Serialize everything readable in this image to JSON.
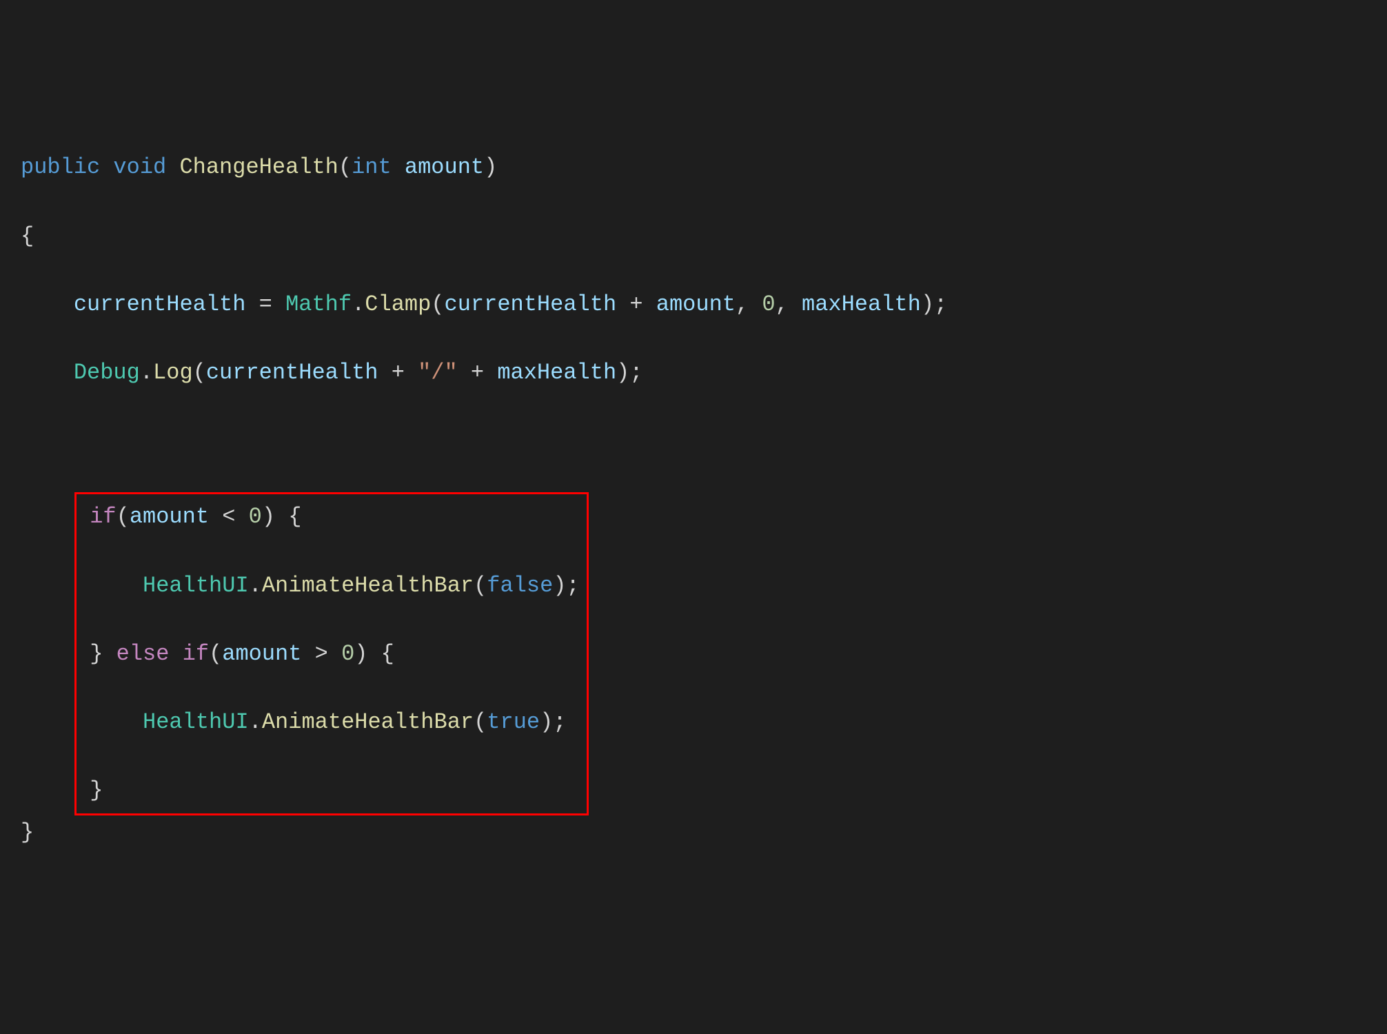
{
  "code": {
    "line1": {
      "kw_public": "public",
      "kw_void": "void",
      "method_name": "ChangeHealth",
      "kw_int": "int",
      "param_name": "amount"
    },
    "line2": {
      "brace": "{"
    },
    "line3": {
      "field1": "currentHealth",
      "assign": " = ",
      "type": "Mathf",
      "dot": ".",
      "method": "Clamp",
      "lparen": "(",
      "field2": "currentHealth",
      "plus": " + ",
      "param": "amount",
      "comma1": ", ",
      "num0": "0",
      "comma2": ", ",
      "field3": "maxHealth",
      "rparen_semi": ");"
    },
    "line4": {
      "type": "Debug",
      "dot": ".",
      "method": "Log",
      "lparen": "(",
      "field1": "currentHealth",
      "plus1": " + ",
      "str": "\"/\"",
      "plus2": " + ",
      "field2": "maxHealth",
      "rparen_semi": ");"
    },
    "line6": {
      "kw_if": "if",
      "lparen": "(",
      "param": "amount",
      "op": " < ",
      "num": "0",
      "rparen_brace": ") {"
    },
    "line7": {
      "type": "HealthUI",
      "dot": ".",
      "method": "AnimateHealthBar",
      "lparen": "(",
      "kw_false": "false",
      "rparen_semi": ");"
    },
    "line8": {
      "rbrace": "}",
      "kw_else": "else",
      "kw_if": "if",
      "lparen": "(",
      "param": "amount",
      "op": " > ",
      "num": "0",
      "rparen_brace": ") {"
    },
    "line9": {
      "type": "HealthUI",
      "dot": ".",
      "method": "AnimateHealthBar",
      "lparen": "(",
      "kw_true": "true",
      "rparen_semi": ");"
    },
    "line10": {
      "rbrace": "}"
    },
    "line11": {
      "rbrace": "}"
    }
  }
}
